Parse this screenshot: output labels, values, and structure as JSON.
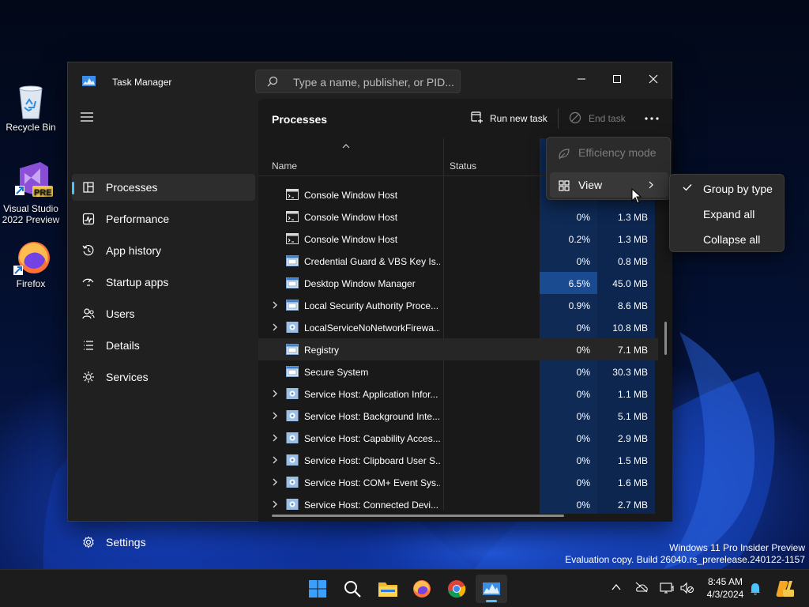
{
  "desktop": {
    "icons": [
      {
        "label": "Recycle Bin"
      },
      {
        "label": "Visual Studio 2022 Preview",
        "badge": "PRE"
      },
      {
        "label": "Firefox"
      }
    ]
  },
  "window": {
    "title": "Task Manager",
    "search_placeholder": "Type a name, publisher, or PID..."
  },
  "sidebar": {
    "items": [
      {
        "label": "Processes",
        "icon": "processes-icon",
        "active": true
      },
      {
        "label": "Performance",
        "icon": "performance-icon"
      },
      {
        "label": "App history",
        "icon": "app-history-icon"
      },
      {
        "label": "Startup apps",
        "icon": "startup-apps-icon"
      },
      {
        "label": "Users",
        "icon": "users-icon"
      },
      {
        "label": "Details",
        "icon": "details-icon"
      },
      {
        "label": "Services",
        "icon": "services-icon"
      }
    ],
    "settings_label": "Settings"
  },
  "toolbar": {
    "page_title": "Processes",
    "run_new_task": "Run new task",
    "end_task": "End task"
  },
  "table": {
    "columns": {
      "name": "Name",
      "status": "Status"
    },
    "rows": [
      {
        "name": "Console Window Host",
        "cpu": "",
        "mem": "",
        "expand": false,
        "icon": "console"
      },
      {
        "name": "Console Window Host",
        "cpu": "0%",
        "mem": "1.3 MB",
        "expand": false,
        "icon": "console"
      },
      {
        "name": "Console Window Host",
        "cpu": "0.2%",
        "mem": "1.3 MB",
        "expand": false,
        "icon": "console"
      },
      {
        "name": "Credential Guard & VBS Key Is...",
        "cpu": "0%",
        "mem": "0.8 MB",
        "expand": false,
        "icon": "app"
      },
      {
        "name": "Desktop Window Manager",
        "cpu": "6.5%",
        "mem": "45.0 MB",
        "expand": false,
        "icon": "app",
        "cpu_hot": true
      },
      {
        "name": "Local Security Authority Proce...",
        "cpu": "0.9%",
        "mem": "8.6 MB",
        "expand": true,
        "icon": "app"
      },
      {
        "name": "LocalServiceNoNetworkFirewa...",
        "cpu": "0%",
        "mem": "10.8 MB",
        "expand": true,
        "icon": "gear"
      },
      {
        "name": "Registry",
        "cpu": "0%",
        "mem": "7.1 MB",
        "expand": false,
        "icon": "app",
        "highlight": true
      },
      {
        "name": "Secure System",
        "cpu": "0%",
        "mem": "30.3 MB",
        "expand": false,
        "icon": "app"
      },
      {
        "name": "Service Host: Application Infor...",
        "cpu": "0%",
        "mem": "1.1 MB",
        "expand": true,
        "icon": "gear"
      },
      {
        "name": "Service Host: Background Inte...",
        "cpu": "0%",
        "mem": "5.1 MB",
        "expand": true,
        "icon": "gear"
      },
      {
        "name": "Service Host: Capability Acces...",
        "cpu": "0%",
        "mem": "2.9 MB",
        "expand": true,
        "icon": "gear"
      },
      {
        "name": "Service Host: Clipboard User S...",
        "cpu": "0%",
        "mem": "1.5 MB",
        "expand": true,
        "icon": "gear"
      },
      {
        "name": "Service Host: COM+ Event Sys...",
        "cpu": "0%",
        "mem": "1.6 MB",
        "expand": true,
        "icon": "gear"
      },
      {
        "name": "Service Host: Connected Devi...",
        "cpu": "0%",
        "mem": "2.7 MB",
        "expand": true,
        "icon": "gear"
      }
    ]
  },
  "context_menu": {
    "items": [
      {
        "label": "Efficiency mode",
        "disabled": true
      },
      {
        "label": "View",
        "submenu": true
      }
    ],
    "view_submenu": [
      {
        "label": "Group by type",
        "checked": true
      },
      {
        "label": "Expand all",
        "checked": false
      },
      {
        "label": "Collapse all",
        "checked": false
      }
    ]
  },
  "watermark": {
    "line1": "Windows 11 Pro Insider Preview",
    "line2": "Evaluation copy. Build 26040.rs_prerelease.240122-1157"
  },
  "taskbar": {
    "apps": [
      "start-icon",
      "search-icon",
      "file-explorer-icon",
      "firefox-icon",
      "chrome-icon",
      "task-manager-icon"
    ],
    "time": "8:45 AM",
    "date": "4/3/2024"
  },
  "colors": {
    "accent": "#4cc2ff",
    "window_bg": "#202020",
    "content_bg": "#191919",
    "cpu_band": "#0e2a55",
    "cpu_hot": "#1a4a8f"
  }
}
